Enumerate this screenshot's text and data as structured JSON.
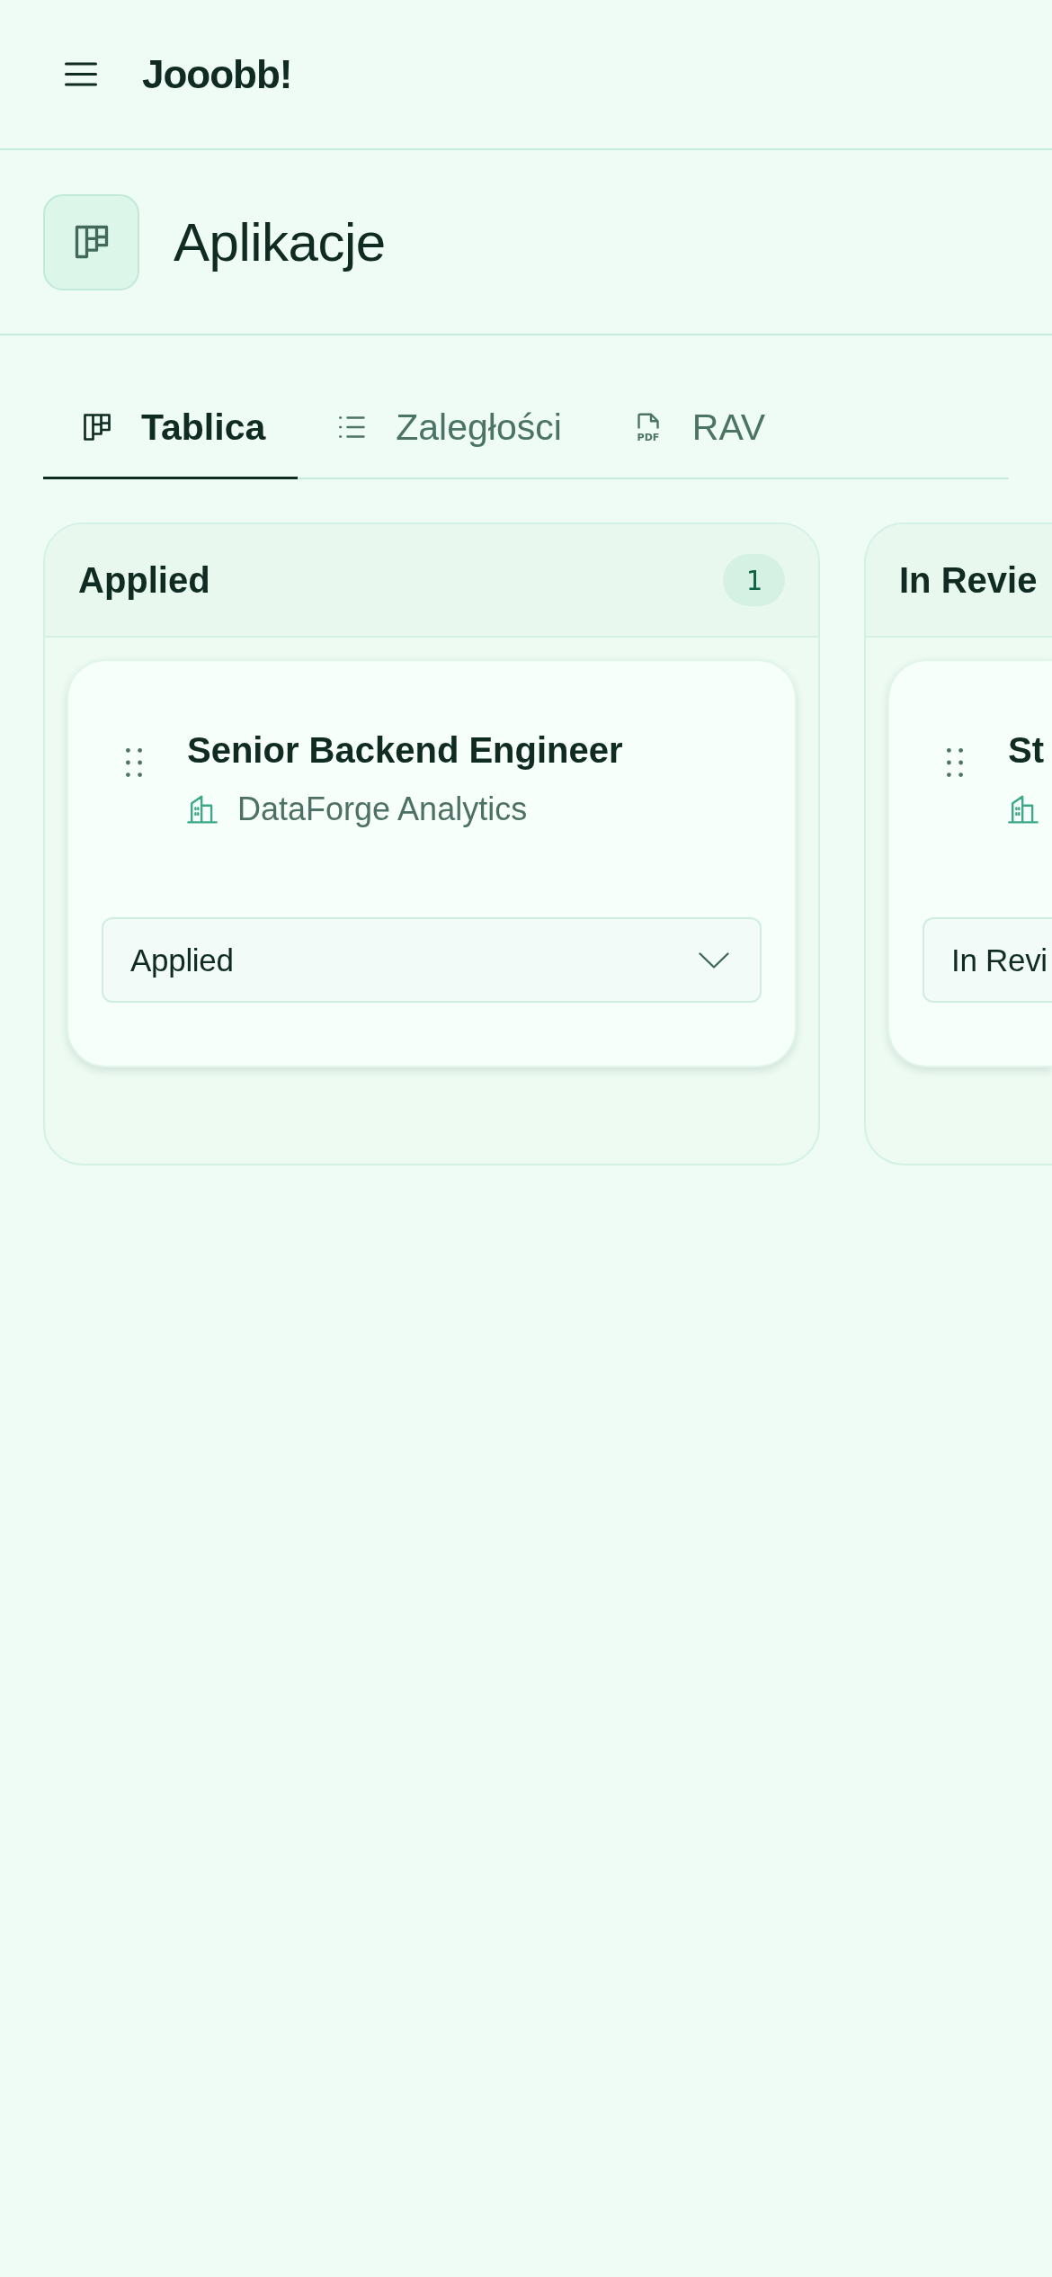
{
  "app_bar": {
    "title": "Jooobb!"
  },
  "page_header": {
    "title": "Aplikacje"
  },
  "tabs": [
    {
      "label": "Tablica",
      "kind": "board",
      "selected": true
    },
    {
      "label": "Zaległości",
      "kind": "list",
      "selected": false
    },
    {
      "label": "RAV",
      "kind": "file",
      "icon_text": "PDF",
      "selected": false
    }
  ],
  "columns": [
    {
      "title": "Applied",
      "count": "1",
      "cards": [
        {
          "title": "Senior Backend Engineer",
          "company": "DataForge Analytics",
          "status": "Applied"
        }
      ]
    },
    {
      "title": "In Revie",
      "cards": [
        {
          "title": "St",
          "status": "In Revi"
        }
      ]
    }
  ]
}
